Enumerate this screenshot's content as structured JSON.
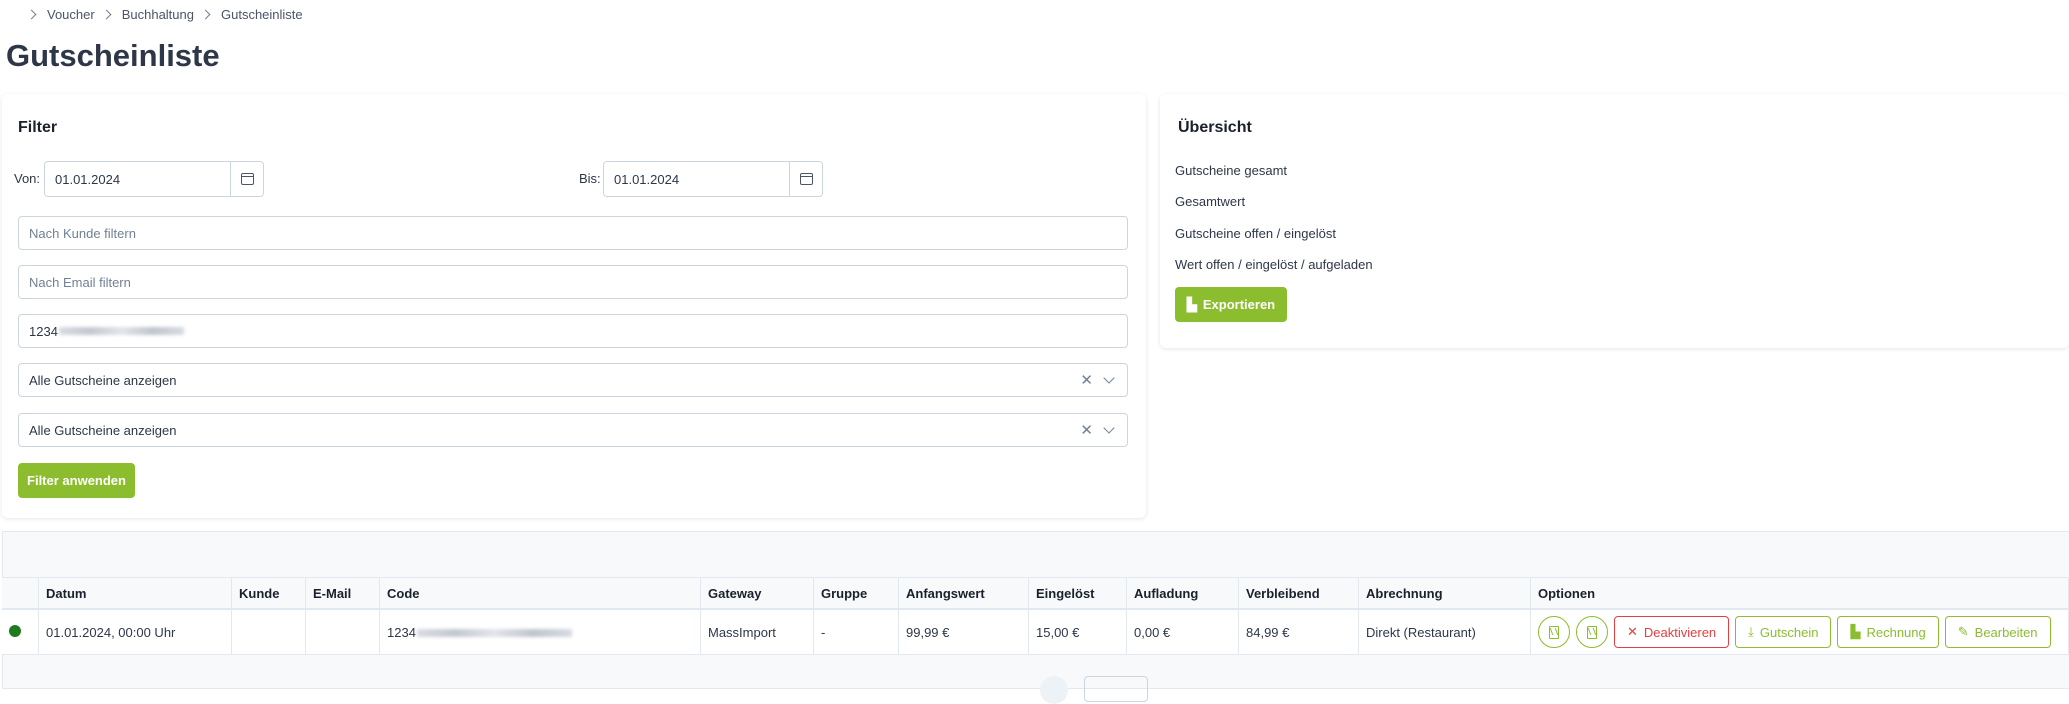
{
  "breadcrumb": [
    "Voucher",
    "Buchhaltung",
    "Gutscheinliste"
  ],
  "page_title": "Gutscheinliste",
  "filter": {
    "title": "Filter",
    "from_label": "Von:",
    "from_value": "01.01.2024",
    "to_label": "Bis:",
    "to_value": "01.01.2024",
    "customer_placeholder": "Nach Kunde filtern",
    "email_placeholder": "Nach Email filtern",
    "code_value_prefix": "1234",
    "select1_value": "Alle Gutscheine anzeigen",
    "select2_value": "Alle Gutscheine anzeigen",
    "apply_label": "Filter anwenden"
  },
  "overview": {
    "title": "Übersicht",
    "rows": [
      "Gutscheine gesamt",
      "Gesamtwert",
      "Gutscheine offen / eingelöst",
      "Wert offen / eingelöst / aufgeladen"
    ],
    "export_label": "Exportieren"
  },
  "table": {
    "headers": [
      "",
      "Datum",
      "Kunde",
      "E-Mail",
      "Code",
      "Gateway",
      "Gruppe",
      "Anfangswert",
      "Eingelöst",
      "Aufladung",
      "Verbleibend",
      "Abrechnung",
      "Optionen"
    ],
    "row": {
      "datum": "01.01.2024, 00:00 Uhr",
      "kunde": "",
      "email": "",
      "code_prefix": "1234",
      "gateway": "MassImport",
      "gruppe": "-",
      "anfangswert": "99,99 €",
      "eingeloest": "15,00 €",
      "aufladung": "0,00 €",
      "verbleibend": "84,99 €",
      "abrechnung": "Direkt (Restaurant)"
    },
    "actions": {
      "deactivate": "Deaktivieren",
      "voucher": "Gutschein",
      "invoice": "Rechnung",
      "edit": "Bearbeiten"
    }
  },
  "colors": {
    "accent": "#8bbd2f",
    "danger": "#e53e3e",
    "status_active": "#1f7a1f"
  }
}
